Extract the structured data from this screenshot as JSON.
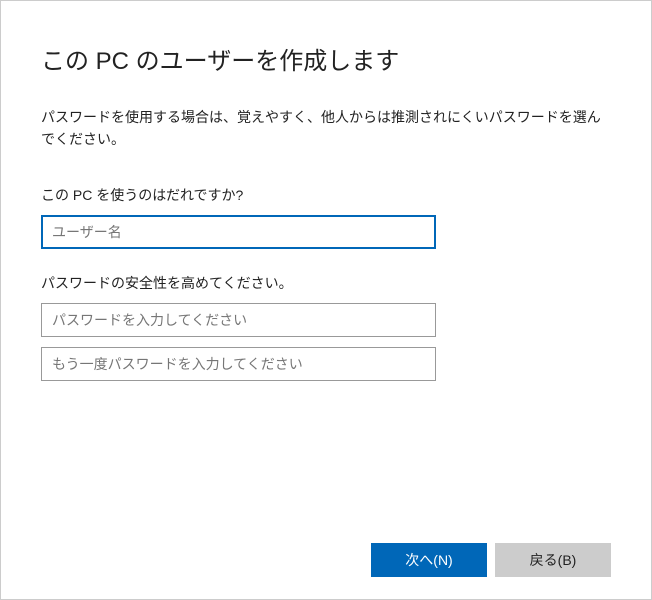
{
  "title": "この PC のユーザーを作成します",
  "description": "パスワードを使用する場合は、覚えやすく、他人からは推測されにくいパスワードを選んでください。",
  "section_user": {
    "label": "この PC を使うのはだれですか?",
    "placeholder": "ユーザー名"
  },
  "section_password": {
    "label": "パスワードの安全性を高めてください。",
    "placeholder1": "パスワードを入力してください",
    "placeholder2": "もう一度パスワードを入力してください"
  },
  "buttons": {
    "next": "次へ(N)",
    "back": "戻る(B)"
  }
}
